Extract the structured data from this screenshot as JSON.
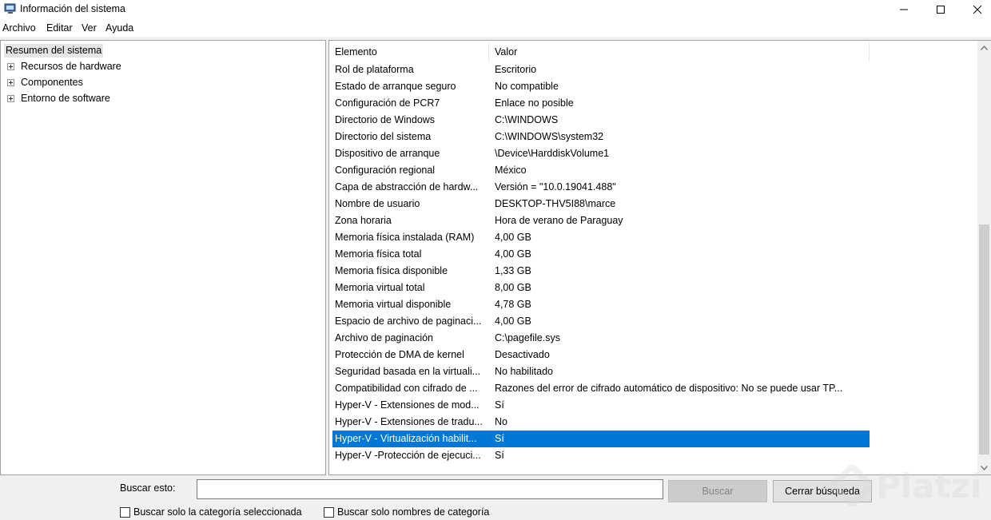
{
  "window": {
    "title": "Información del sistema",
    "icon": "system-info-icon"
  },
  "menu": [
    "Archivo",
    "Editar",
    "Ver",
    "Ayuda"
  ],
  "tree": {
    "root": "Resumen del sistema",
    "children": [
      "Recursos de hardware",
      "Componentes",
      "Entorno de software"
    ]
  },
  "list": {
    "columns": [
      "Elemento",
      "Valor"
    ],
    "rows": [
      {
        "k": "Rol de plataforma",
        "v": "Escritorio"
      },
      {
        "k": "Estado de arranque seguro",
        "v": "No compatible"
      },
      {
        "k": "Configuración de PCR7",
        "v": "Enlace no posible"
      },
      {
        "k": "Directorio de Windows",
        "v": "C:\\WINDOWS"
      },
      {
        "k": "Directorio del sistema",
        "v": "C:\\WINDOWS\\system32"
      },
      {
        "k": "Dispositivo de arranque",
        "v": "\\Device\\HarddiskVolume1"
      },
      {
        "k": "Configuración regional",
        "v": "México"
      },
      {
        "k": "Capa de abstracción de hardw...",
        "v": "Versión = \"10.0.19041.488\""
      },
      {
        "k": "Nombre de usuario",
        "v": "DESKTOP-THV5I88\\marce"
      },
      {
        "k": "Zona horaria",
        "v": "Hora de verano de Paraguay"
      },
      {
        "k": "Memoria física instalada (RAM)",
        "v": "4,00 GB"
      },
      {
        "k": "Memoria física total",
        "v": "4,00 GB"
      },
      {
        "k": "Memoria física disponible",
        "v": "1,33 GB"
      },
      {
        "k": "Memoria virtual total",
        "v": "8,00 GB"
      },
      {
        "k": "Memoria virtual disponible",
        "v": "4,78 GB"
      },
      {
        "k": "Espacio de archivo de paginaci...",
        "v": "4,00 GB"
      },
      {
        "k": "Archivo de paginación",
        "v": "C:\\pagefile.sys"
      },
      {
        "k": "Protección de DMA de kernel",
        "v": "Desactivado"
      },
      {
        "k": "Seguridad basada en la virtuali...",
        "v": "No habilitado"
      },
      {
        "k": "Compatibilidad con cifrado de ...",
        "v": "Razones del error de cifrado automático de dispositivo: No se puede usar TP..."
      },
      {
        "k": "Hyper-V - Extensiones de mod...",
        "v": "Sí"
      },
      {
        "k": "Hyper-V - Extensiones de tradu...",
        "v": "No"
      },
      {
        "k": "Hyper-V - Virtualización habilit...",
        "v": "Sí",
        "selected": true
      },
      {
        "k": "Hyper-V -Protección de ejecuci...",
        "v": "Sí"
      }
    ]
  },
  "search": {
    "label": "Buscar esto:",
    "value": "",
    "search_button": "Buscar",
    "clear_button": "Cerrar búsqueda",
    "option_selected_category": "Buscar solo la categoría seleccionada",
    "option_category_names": "Buscar solo nombres de categoría"
  },
  "watermark": "Platzi",
  "colors": {
    "selection": "#0078d7",
    "watermark": "#d8dcd3"
  }
}
